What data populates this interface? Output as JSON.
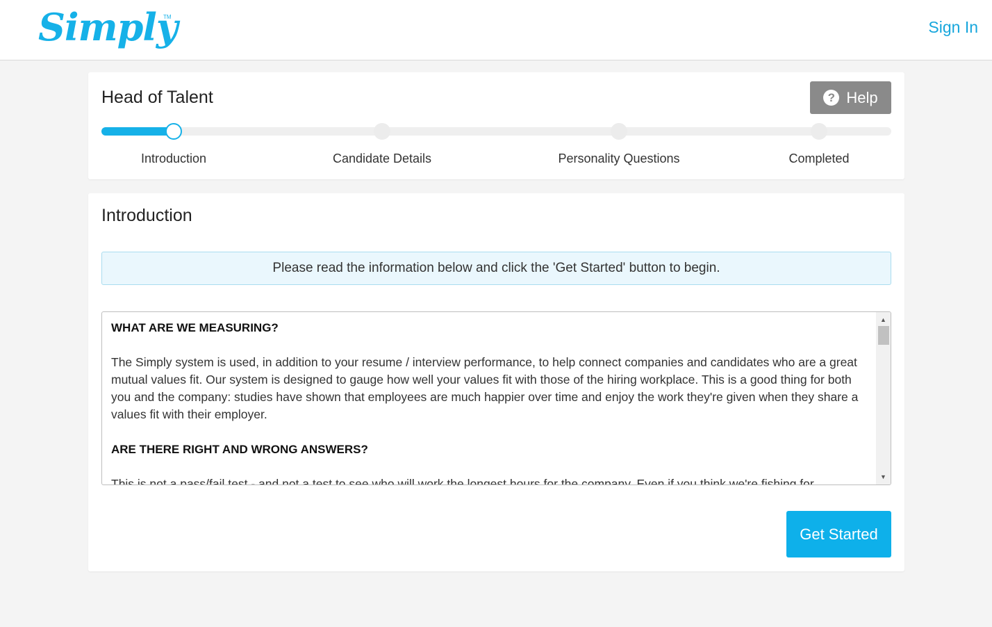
{
  "header": {
    "logo_text": "Simply",
    "logo_tm": "TM",
    "signin_label": "Sign In"
  },
  "progress_card": {
    "job_title": "Head of Talent",
    "help_label": "Help",
    "help_icon": "question-circle-icon",
    "progress_fraction": 0.092,
    "steps": [
      {
        "label": "Introduction",
        "state": "active"
      },
      {
        "label": "Candidate Details",
        "state": "pending"
      },
      {
        "label": "Personality Questions",
        "state": "pending"
      },
      {
        "label": "Completed",
        "state": "pending"
      }
    ]
  },
  "intro_card": {
    "title": "Introduction",
    "banner_text": "Please read the information below and click the 'Get Started' button to begin.",
    "sections": [
      {
        "heading": "WHAT ARE WE MEASURING?",
        "body": "The Simply system is used, in addition to your resume / interview performance, to help connect companies and candidates who are a great mutual values fit. Our system is designed to gauge how well your values fit with those of the hiring workplace. This is a good thing for both you and the company: studies have shown that employees are much happier over time and enjoy the work they're given when they share a values fit with their employer."
      },
      {
        "heading": "ARE THERE RIGHT AND WRONG ANSWERS?",
        "body": "This is not a pass/fail test - and not a test to see who will work the longest hours for the company. Even if you think we're fishing for"
      }
    ],
    "get_started_label": "Get Started"
  },
  "colors": {
    "brand": "#16b1e8",
    "help_button": "#8a8a8a",
    "banner_bg": "#eaf7fd",
    "page_bg": "#f4f4f4"
  }
}
